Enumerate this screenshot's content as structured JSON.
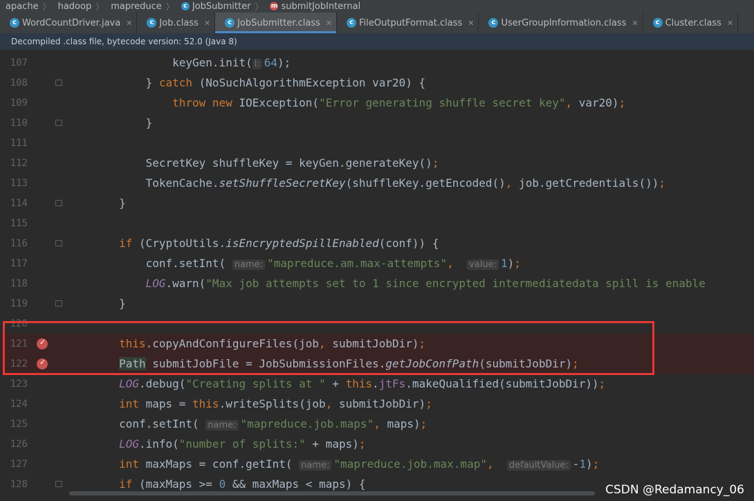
{
  "breadcrumb": [
    {
      "label": "apache",
      "icon": ""
    },
    {
      "label": "hadoop",
      "icon": ""
    },
    {
      "label": "mapreduce",
      "icon": ""
    },
    {
      "label": "JobSubmitter",
      "icon": "class-icon"
    },
    {
      "label": "submitJobInternal",
      "icon": "method-icon"
    }
  ],
  "tabs": [
    {
      "label": "WordCountDriver.java",
      "active": false
    },
    {
      "label": "Job.class",
      "active": false
    },
    {
      "label": "JobSubmitter.class",
      "active": true
    },
    {
      "label": "FileOutputFormat.class",
      "active": false
    },
    {
      "label": "UserGroupInformation.class",
      "active": false
    },
    {
      "label": "Cluster.class",
      "active": false
    }
  ],
  "banner": "Decompiled .class file, bytecode version: 52.0 (Java 8)",
  "lines": [
    {
      "n": "107",
      "fold": false,
      "bp": false,
      "html": "                <span>keyGen.init(</span><span class=\"hint\">i:</span><span class=\"num\">64</span><span>);</span>"
    },
    {
      "n": "108",
      "fold": true,
      "bp": false,
      "html": "            } <span class=\"kw\">catch</span> (NoSuchAlgorithmException var20) {"
    },
    {
      "n": "109",
      "fold": false,
      "bp": false,
      "html": "                <span class=\"kw\">throw new</span> IOException(<span class=\"str\">\"Error generating shuffle secret key\"</span><span class=\"kw\">,</span> var20)<span class=\"kw\">;</span>"
    },
    {
      "n": "110",
      "fold": true,
      "bp": false,
      "html": "            }"
    },
    {
      "n": "111",
      "fold": false,
      "bp": false,
      "html": ""
    },
    {
      "n": "112",
      "fold": false,
      "bp": false,
      "html": "            SecretKey shuffleKey = keyGen.generateKey()<span class=\"kw\">;</span>"
    },
    {
      "n": "113",
      "fold": false,
      "bp": false,
      "html": "            TokenCache.<span class=\"it\">setShuffleSecretKey</span>(shuffleKey.getEncoded()<span class=\"kw\">,</span> job.getCredentials())<span class=\"kw\">;</span>"
    },
    {
      "n": "114",
      "fold": true,
      "bp": false,
      "html": "        }"
    },
    {
      "n": "115",
      "fold": false,
      "bp": false,
      "html": ""
    },
    {
      "n": "116",
      "fold": true,
      "bp": false,
      "html": "        <span class=\"kw\">if</span> (CryptoUtils.<span class=\"it\">isEncryptedSpillEnabled</span>(conf)) {"
    },
    {
      "n": "117",
      "fold": false,
      "bp": false,
      "html": "            conf.setInt( <span class=\"hint\">name:</span><span class=\"str\">\"mapreduce.am.max-attempts\"</span><span class=\"kw\">,</span>  <span class=\"hint\">value:</span><span class=\"num\">1</span>)<span class=\"kw\">;</span>"
    },
    {
      "n": "118",
      "fold": false,
      "bp": false,
      "html": "            <span class=\"fld\">LOG</span>.warn(<span class=\"str\">\"Max job attempts set to 1 since encrypted intermediatedata spill is enable</span>"
    },
    {
      "n": "119",
      "fold": true,
      "bp": false,
      "html": "        }"
    },
    {
      "n": "120",
      "fold": false,
      "bp": false,
      "html": ""
    },
    {
      "n": "121",
      "fold": false,
      "bp": true,
      "html": "        <span class=\"kw\">this</span>.copyAndConfigureFiles(job<span class=\"kw\">,</span> submitJobDir)<span class=\"kw\">;</span>"
    },
    {
      "n": "122",
      "fold": false,
      "bp": true,
      "html": "        <span style=\"background:#344134\">Path</span> submitJobFile = JobSubmissionFiles.<span class=\"it\">getJobConfPath</span>(submitJobDir)<span class=\"kw\">;</span>"
    },
    {
      "n": "123",
      "fold": false,
      "bp": false,
      "html": "        <span class=\"fld\">LOG</span>.debug(<span class=\"str\">\"Creating splits at \"</span> + <span class=\"kw\">this</span>.<span style=\"color:#9876aa\">jtFs</span>.makeQualified(submitJobDir))<span class=\"kw\">;</span>"
    },
    {
      "n": "124",
      "fold": false,
      "bp": false,
      "html": "        <span class=\"kw\">int</span> maps = <span class=\"kw\">this</span>.writeSplits(job<span class=\"kw\">,</span> submitJobDir)<span class=\"kw\">;</span>"
    },
    {
      "n": "125",
      "fold": false,
      "bp": false,
      "html": "        conf.setInt( <span class=\"hint\">name:</span><span class=\"str\">\"mapreduce.job.maps\"</span><span class=\"kw\">,</span> maps)<span class=\"kw\">;</span>"
    },
    {
      "n": "126",
      "fold": false,
      "bp": false,
      "html": "        <span class=\"fld\">LOG</span>.info(<span class=\"str\">\"number of splits:\"</span> + maps)<span class=\"kw\">;</span>"
    },
    {
      "n": "127",
      "fold": false,
      "bp": false,
      "html": "        <span class=\"kw\">int</span> maxMaps = conf.getInt( <span class=\"hint\">name:</span><span class=\"str\">\"mapreduce.job.max.map\"</span><span class=\"kw\">,</span>  <span class=\"hint\">defaultValue:</span>-<span class=\"num\">1</span>)<span class=\"kw\">;</span>"
    },
    {
      "n": "128",
      "fold": true,
      "bp": false,
      "html": "        <span class=\"kw\">if</span> (maxMaps >= <span class=\"num\">0</span> && maxMaps < maps) {"
    }
  ],
  "watermark": "CSDN @Redamancy_06"
}
